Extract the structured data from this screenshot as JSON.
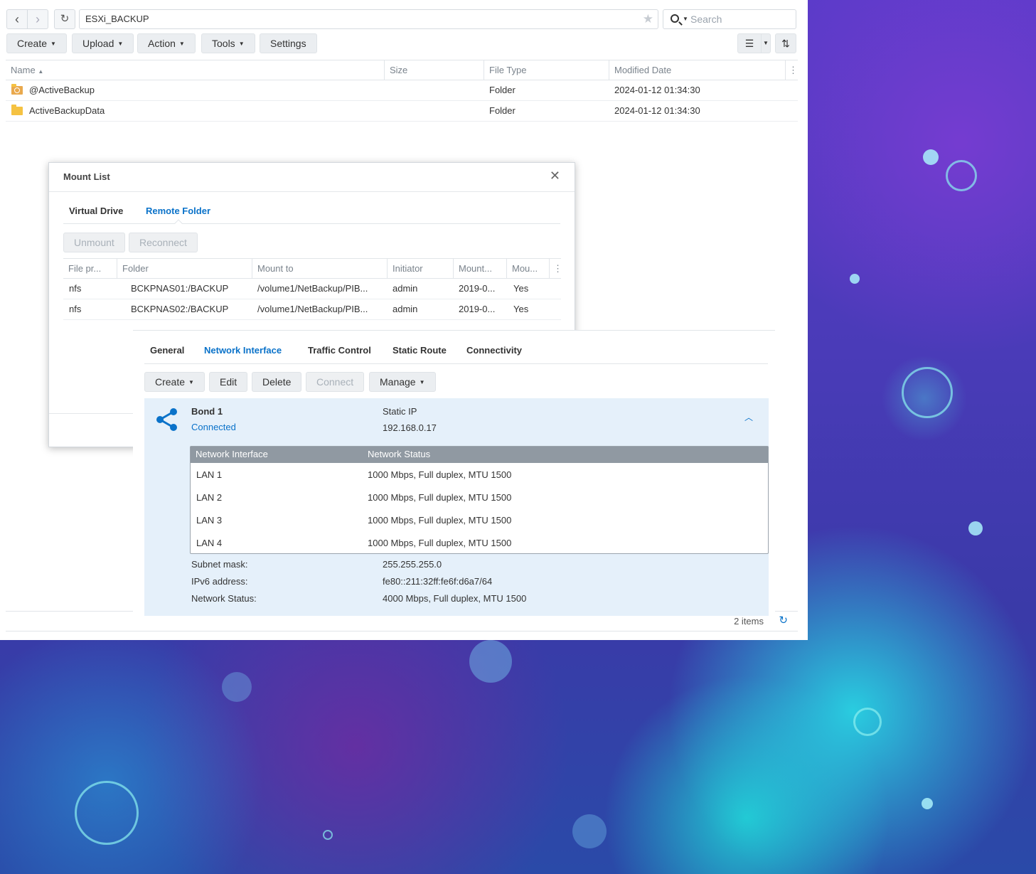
{
  "file_station": {
    "path": "ESXi_BACKUP",
    "search_placeholder": "Search",
    "toolbar": {
      "create": "Create",
      "upload": "Upload",
      "action": "Action",
      "tools": "Tools",
      "settings": "Settings"
    },
    "columns": {
      "name": "Name",
      "size": "Size",
      "file_type": "File Type",
      "modified": "Modified Date"
    },
    "rows": [
      {
        "name": "@ActiveBackup",
        "size": "",
        "type": "Folder",
        "modified": "2024-01-12 01:34:30"
      },
      {
        "name": "ActiveBackupData",
        "size": "",
        "type": "Folder",
        "modified": "2024-01-12 01:34:30"
      }
    ],
    "item_count": "2 items"
  },
  "mount_list": {
    "title": "Mount List",
    "tabs": [
      "Virtual Drive",
      "Remote Folder"
    ],
    "active_tab": "Remote Folder",
    "buttons": {
      "unmount": "Unmount",
      "reconnect": "Reconnect"
    },
    "columns": [
      "File pr...",
      "Folder",
      "Mount to",
      "Initiator",
      "Mount...",
      "Mou..."
    ],
    "rows": [
      {
        "protocol": "nfs",
        "folder": "BCKPNAS01:/BACKUP",
        "mount_to": "/volume1/NetBackup/PIB...",
        "initiator": "admin",
        "mount_time": "2019-0...",
        "auto": "Yes"
      },
      {
        "protocol": "nfs",
        "folder": "BCKPNAS02:/BACKUP",
        "mount_to": "/volume1/NetBackup/PIB...",
        "initiator": "admin",
        "mount_time": "2019-0...",
        "auto": "Yes"
      }
    ]
  },
  "network": {
    "tabs": [
      "General",
      "Network Interface",
      "Traffic Control",
      "Static Route",
      "Connectivity"
    ],
    "active_tab": "Network Interface",
    "buttons": {
      "create": "Create",
      "edit": "Edit",
      "delete": "Delete",
      "connect": "Connect",
      "manage": "Manage"
    },
    "bond": {
      "name": "Bond 1",
      "status": "Connected",
      "ip_mode": "Static IP",
      "ip": "192.168.0.17"
    },
    "iface_columns": {
      "iface": "Network Interface",
      "status": "Network Status"
    },
    "interfaces": [
      {
        "name": "LAN 1",
        "status": "1000 Mbps, Full duplex, MTU 1500"
      },
      {
        "name": "LAN 2",
        "status": "1000 Mbps, Full duplex, MTU 1500"
      },
      {
        "name": "LAN 3",
        "status": "1000 Mbps, Full duplex, MTU 1500"
      },
      {
        "name": "LAN 4",
        "status": "1000 Mbps, Full duplex, MTU 1500"
      }
    ],
    "details": {
      "subnet_label": "Subnet mask:",
      "subnet": "255.255.255.0",
      "ipv6_label": "IPv6 address:",
      "ipv6": "fe80::211:32ff:fe6f:d6a7/64",
      "status_label": "Network Status:",
      "status": "4000 Mbps, Full duplex, MTU 1500"
    }
  },
  "colors": {
    "accent": "#0a72c9",
    "card_bg": "#e5f0fa",
    "table_header": "#9099a2"
  }
}
